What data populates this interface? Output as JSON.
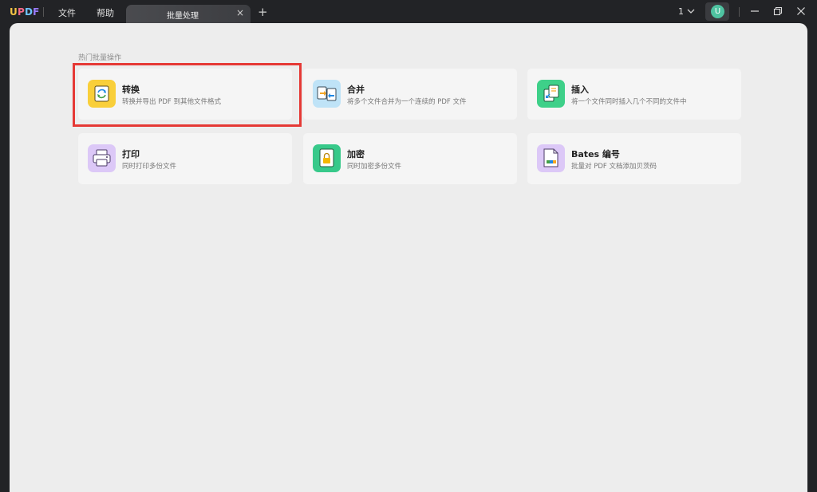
{
  "app": {
    "logo_text": "UPDF",
    "menu": {
      "file": "文件",
      "help": "帮助"
    },
    "tab": {
      "label": "批量处理",
      "close": "×"
    },
    "add_tab": "+",
    "page_number": "1",
    "avatar_letter": "U"
  },
  "main": {
    "section_title": "热门批量操作",
    "cards": [
      {
        "title": "转换",
        "desc": "转换并导出 PDF 到其他文件格式",
        "icon": "convert-icon",
        "color": "#f9cf3a"
      },
      {
        "title": "合并",
        "desc": "将多个文件合并为一个连续的 PDF 文件",
        "icon": "merge-icon",
        "color": "#bfe3f7"
      },
      {
        "title": "插入",
        "desc": "将一个文件同时插入几个不同的文件中",
        "icon": "insert-icon",
        "color": "#3ed089"
      },
      {
        "title": "打印",
        "desc": "同时打印多份文件",
        "icon": "print-icon",
        "color": "#dcc8f7"
      },
      {
        "title": "加密",
        "desc": "同时加密多份文件",
        "icon": "encrypt-icon",
        "color": "#37c98a"
      },
      {
        "title": "Bates 编号",
        "desc": "批量对 PDF 文档添加贝茨码",
        "icon": "bates-icon",
        "color": "#dcc8f7"
      }
    ]
  },
  "colors": {
    "highlight": "#e53935",
    "avatar": "#4fc3a1"
  }
}
